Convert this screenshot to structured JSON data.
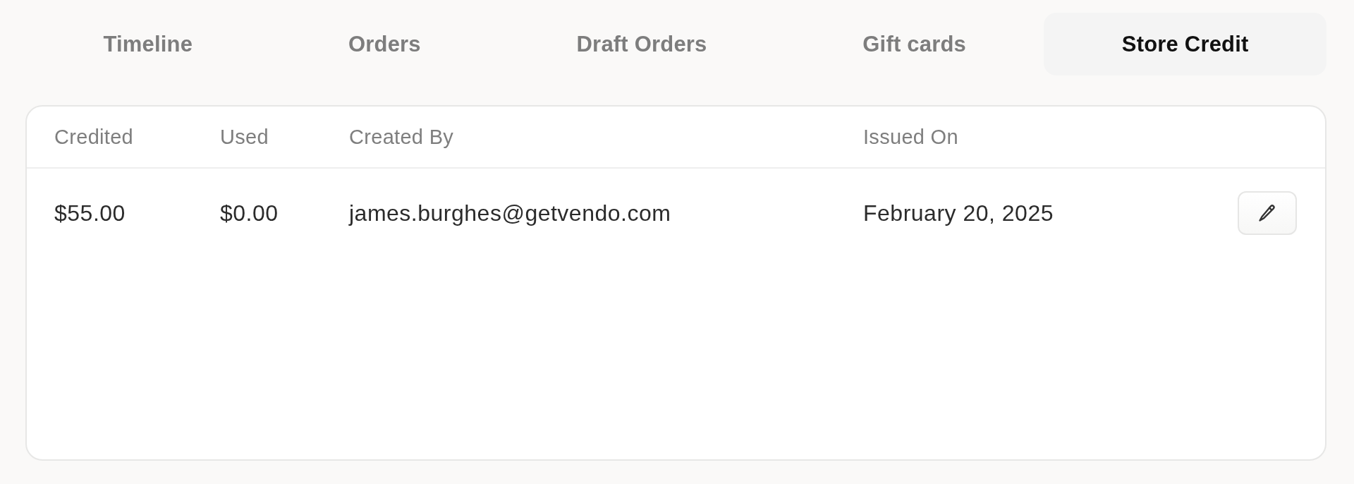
{
  "tabs": [
    {
      "label": "Timeline",
      "selected": false
    },
    {
      "label": "Orders",
      "selected": false
    },
    {
      "label": "Draft Orders",
      "selected": false
    },
    {
      "label": "Gift cards",
      "selected": false
    },
    {
      "label": "Store Credit",
      "selected": true
    }
  ],
  "table": {
    "columns": [
      "Credited",
      "Used",
      "Created By",
      "Issued On"
    ],
    "rows": [
      {
        "cells": [
          "$55.00",
          "$0.00",
          "james.burghes@getvendo.com",
          "February 20, 2025"
        ]
      }
    ]
  }
}
